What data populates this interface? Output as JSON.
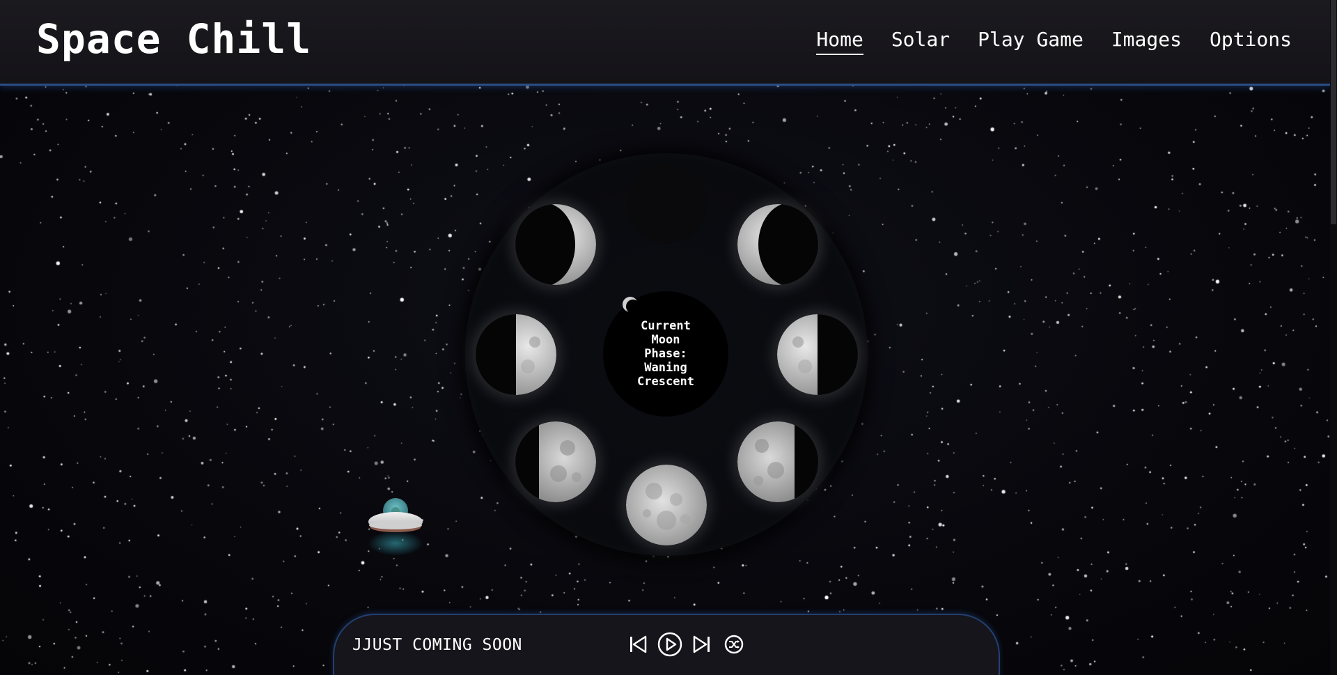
{
  "header": {
    "brand": "Space Chill",
    "nav": [
      {
        "label": "Home",
        "active": true
      },
      {
        "label": "Solar",
        "active": false
      },
      {
        "label": "Play Game",
        "active": false
      },
      {
        "label": "Images",
        "active": false
      },
      {
        "label": "Options",
        "active": false
      }
    ]
  },
  "moon_wheel": {
    "center_text": "Current\nMoon\nPhase:\nWaning\nCrescent",
    "phases": [
      "new-moon",
      "waxing-crescent",
      "first-quarter",
      "waxing-gibbous",
      "full-moon",
      "waning-gibbous",
      "last-quarter",
      "waning-crescent"
    ]
  },
  "player": {
    "track_title": "JJUST COMING SOON",
    "controls": [
      "previous-icon",
      "play-icon",
      "next-icon",
      "shuffle-icon"
    ]
  },
  "colors": {
    "header_bg": "#1b1a1f",
    "accent_blue": "#2c4d85",
    "text": "#ffffff",
    "space_bg": "#07070b"
  }
}
